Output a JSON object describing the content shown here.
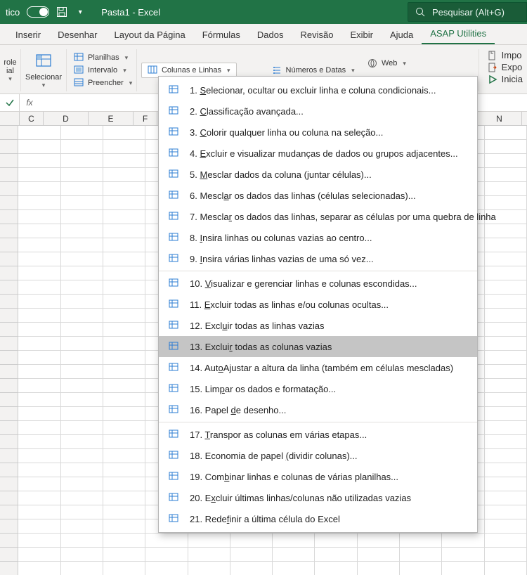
{
  "title_bar": {
    "auto_mode_label": "tico",
    "filename": "Pasta1 - Excel",
    "search_placeholder": "Pesquisar (Alt+G)"
  },
  "tabs": {
    "items": [
      {
        "label": "Inserir"
      },
      {
        "label": "Desenhar"
      },
      {
        "label": "Layout da Página"
      },
      {
        "label": "Fórmulas"
      },
      {
        "label": "Dados"
      },
      {
        "label": "Revisão"
      },
      {
        "label": "Exibir"
      },
      {
        "label": "Ajuda"
      },
      {
        "label": "ASAP Utilities",
        "active": true
      }
    ]
  },
  "ribbon": {
    "group1_line1": "role",
    "group1_line2": "ial",
    "selecionar_label": "Selecionar",
    "planilhas_label": "Planilhas",
    "intervalo_label": "Intervalo",
    "preencher_label": "Preencher",
    "colunas_linhas_label": "Colunas e Linhas",
    "numeros_datas_label": "Números e Datas",
    "web_label": "Web",
    "impo_label": "Impo",
    "expo_label": "Expo",
    "inicia_label": "Inicia"
  },
  "formula_bar": {
    "fx_label": "fx"
  },
  "columns": [
    "C",
    "D",
    "E",
    "F",
    "",
    "",
    "",
    "",
    "",
    "",
    "",
    "N"
  ],
  "menu": {
    "items": [
      {
        "num": "1.",
        "u": "S",
        "rest": "elecionar, ocultar ou excluir linha e coluna condicionais..."
      },
      {
        "num": "2.",
        "u": "C",
        "rest": "lassificação avançada..."
      },
      {
        "num": "3.",
        "u": "C",
        "pre": "",
        "rest": "olorir qualquer linha ou coluna na seleção..."
      },
      {
        "num": "4.",
        "u": "E",
        "rest": "xcluir e visualizar mudanças de dados ou grupos adjacentes..."
      },
      {
        "num": "5.",
        "u": "M",
        "rest": "esclar dados da coluna (juntar células)..."
      },
      {
        "num": "6.",
        "u": "",
        "pre": "Mescl",
        "urest": "a",
        "rest2": "r os dados das linhas (células selecionadas)..."
      },
      {
        "num": "7.",
        "u": "",
        "pre": "Mescla",
        "urest": "r",
        "rest2": " os dados das linhas, separar as células por uma quebra de linha"
      },
      {
        "num": "8.",
        "u": "I",
        "rest": "nsira linhas ou colunas vazias ao centro..."
      },
      {
        "num": "9.",
        "u": "I",
        "pre": "",
        "rest": "nsira várias linhas vazias de uma só vez..."
      },
      {
        "num": "10.",
        "u": "V",
        "rest": "isualizar e gerenciar linhas e colunas escondidas..."
      },
      {
        "num": "11.",
        "u": "E",
        "rest": "xcluir todas as linhas e/ou colunas ocultas..."
      },
      {
        "num": "12.",
        "u": "",
        "pre": "Excl",
        "urest": "u",
        "rest2": "ir todas as linhas vazias"
      },
      {
        "num": "13.",
        "u": "",
        "pre": "Exclui",
        "urest": "r",
        "rest2": " todas as colunas vazias",
        "highlighted": true
      },
      {
        "num": "14.",
        "u": "",
        "pre": "Aut",
        "urest": "o",
        "rest2": "Ajustar a altura da linha (também em células mescladas)"
      },
      {
        "num": "15.",
        "u": "",
        "pre": "Lim",
        "urest": "p",
        "rest2": "ar os dados e formatação..."
      },
      {
        "num": "16.",
        "u": "",
        "pre": "Papel ",
        "urest": "d",
        "rest2": "e desenho..."
      },
      {
        "num": "17.",
        "u": "T",
        "rest": "ranspor as colunas em várias etapas..."
      },
      {
        "num": "18.",
        "u": "",
        "pre": "Economia de papel ",
        "urest": "(",
        "rest2": "dividir colunas)..."
      },
      {
        "num": "19.",
        "u": "",
        "pre": "Com",
        "urest": "b",
        "rest2": "inar linhas e colunas de várias planilhas..."
      },
      {
        "num": "20.",
        "u": "",
        "pre": "E",
        "urest": "x",
        "rest2": "cluir últimas linhas/colunas não utilizadas vazias"
      },
      {
        "num": "21.",
        "u": "",
        "pre": "Rede",
        "urest": "f",
        "rest2": "inir a última célula do Excel"
      }
    ]
  }
}
